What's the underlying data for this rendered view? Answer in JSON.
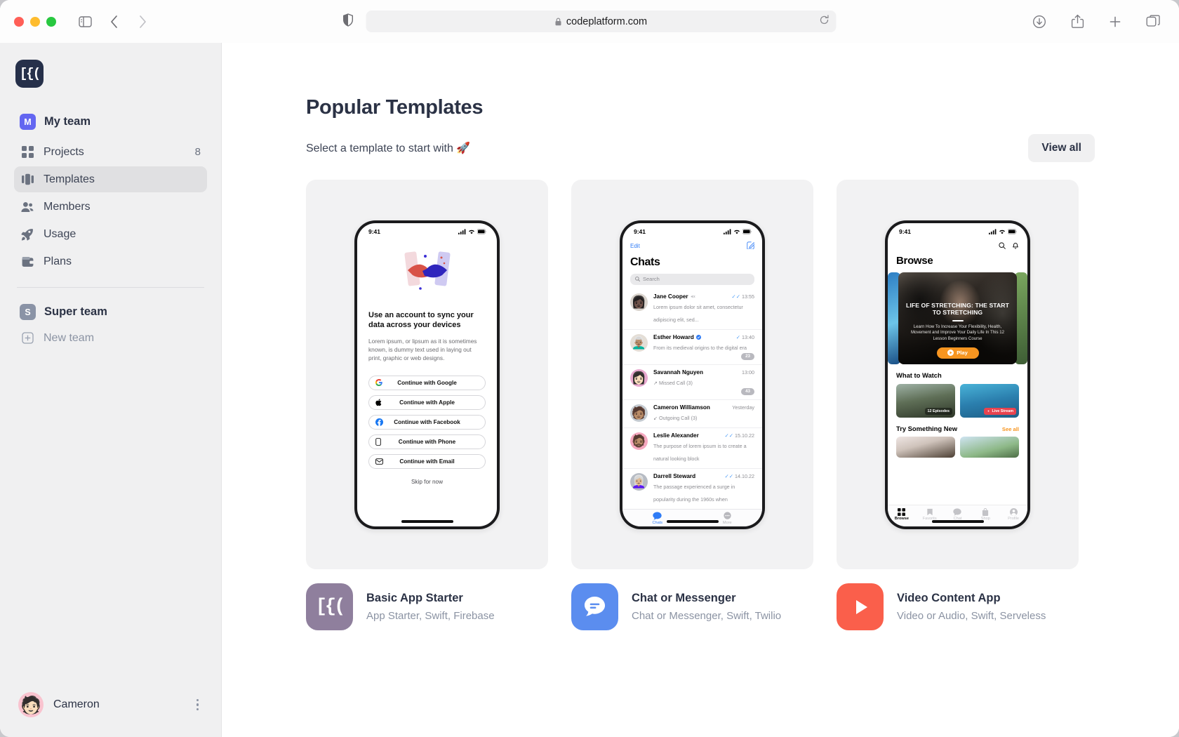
{
  "browser": {
    "url": "codeplatform.com",
    "lock_icon": "lock-icon",
    "shield_icon": "shield-icon",
    "reload_icon": "reload-icon",
    "back_icon": "back-chevron-icon",
    "forward_icon": "forward-chevron-icon",
    "sidebar_toggle_icon": "sidebar-toggle-icon",
    "downloads_icon": "downloads-icon",
    "share_icon": "share-icon",
    "new_tab_icon": "plus-icon",
    "tabs_icon": "tab-overview-icon"
  },
  "sidebar": {
    "brand": "[{(",
    "team": {
      "initial": "M",
      "name": "My team",
      "color": "#6366f1"
    },
    "items": [
      {
        "label": "Projects",
        "count": "8",
        "icon": "grid-icon",
        "active": false
      },
      {
        "label": "Templates",
        "count": "",
        "icon": "templates-icon",
        "active": true
      },
      {
        "label": "Members",
        "count": "",
        "icon": "members-icon",
        "active": false
      },
      {
        "label": "Usage",
        "count": "",
        "icon": "rocket-icon",
        "active": false
      },
      {
        "label": "Plans",
        "count": "",
        "icon": "wallet-icon",
        "active": false
      }
    ],
    "second_team": {
      "initial": "S",
      "name": "Super team",
      "color": "#8a93a6"
    },
    "new_team": {
      "label": "New team",
      "icon": "plus-box-icon"
    },
    "user": {
      "name": "Cameron",
      "menu_icon": "kebab-menu-icon"
    }
  },
  "main": {
    "title": "Popular Templates",
    "subtitle": "Select a template to start with 🚀",
    "view_all": "View all"
  },
  "templates": [
    {
      "title": "Basic App Starter",
      "subtitle": "App Starter, Swift, Firebase",
      "icon_glyph": "[{(",
      "icon_color": "#8f7f9d"
    },
    {
      "title": "Chat or Messenger",
      "subtitle": "Chat or Messenger, Swift, Twilio",
      "icon_glyph": "chat-bubble-icon",
      "icon_color": "#5b8def"
    },
    {
      "title": "Video Content App",
      "subtitle": "Video or Audio, Swift, Serveless",
      "icon_glyph": "play-icon",
      "icon_color": "#fa5f4b"
    }
  ],
  "phone1": {
    "status_time": "9:41",
    "heading": "Use an account to sync your data across your devices",
    "paragraph": "Lorem ipsum, or lipsum as it is sometimes known, is dummy text used in laying out print, graphic or web designs.",
    "buttons": [
      {
        "label": "Continue with Google",
        "icon": "google-icon"
      },
      {
        "label": "Continue with Apple",
        "icon": "apple-icon"
      },
      {
        "label": "Continue with Facebook",
        "icon": "facebook-icon"
      },
      {
        "label": "Continue with Phone",
        "icon": "phone-icon"
      },
      {
        "label": "Continue with Email",
        "icon": "email-icon"
      }
    ],
    "skip": "Skip for now"
  },
  "phone2": {
    "status_time": "9:41",
    "edit": "Edit",
    "compose_icon": "compose-icon",
    "title": "Chats",
    "search_placeholder": "Search",
    "chats": [
      {
        "name": "Jane Cooper",
        "muted": true,
        "verified": false,
        "message": "Lorem ipsum dolor sit amet, consectetur adipiscing elit, sed...",
        "time": "13:55",
        "ticks": "double",
        "badge": "",
        "avatar_color": "#d9d3cc",
        "face": "👩🏿"
      },
      {
        "name": "Esther Howard",
        "muted": false,
        "verified": true,
        "message": "From its medieval origins to the digital era",
        "time": "13:40",
        "ticks": "single",
        "badge": "23",
        "avatar_color": "#e4ded6",
        "face": "👨🏽‍🦳"
      },
      {
        "name": "Savannah Nguyen",
        "muted": false,
        "verified": false,
        "message": "↗ Missed Call (3)",
        "time": "13:00",
        "ticks": "none",
        "badge": "43",
        "avatar_color": "#e8a9cf",
        "face": "👩🏻"
      },
      {
        "name": "Cameron Williamson",
        "muted": false,
        "verified": false,
        "message": "↙ Outgoing Call (3)",
        "time": "Yesterday",
        "ticks": "none",
        "badge": "",
        "avatar_color": "#c5cbd1",
        "face": "🧑🏽"
      },
      {
        "name": "Leslie Alexander",
        "muted": false,
        "verified": false,
        "message": "The purpose of lorem ipsum is to create a natural looking block",
        "time": "15.10.22",
        "ticks": "double",
        "badge": "",
        "avatar_color": "#f5a8bf",
        "face": "🧔🏽"
      },
      {
        "name": "Darrell Steward",
        "muted": false,
        "verified": false,
        "message": "The passage experienced a surge in popularity during the 1960s when",
        "time": "14.10.22",
        "ticks": "double",
        "badge": "",
        "avatar_color": "#b7bcc4",
        "face": "👩🏼‍🦳"
      }
    ],
    "tabs": [
      {
        "label": "Chats",
        "icon": "chat-bubble-icon",
        "active": true
      },
      {
        "label": "More",
        "icon": "more-dots-icon",
        "active": false
      }
    ]
  },
  "phone3": {
    "status_time": "9:41",
    "search_icon": "search-icon",
    "bell_icon": "bell-icon",
    "title": "Browse",
    "hero": {
      "heading": "LIFE OF STRETCHING: THE START TO STRETCHING",
      "paragraph": "Learn How To Increase Your Flexibility, Health, Movement and Improve Your Daily Life In This 12 Lesson Beginners Course",
      "play_label": "Play",
      "play_icon": "play-circle-icon"
    },
    "section1": "What to Watch",
    "thumb1_tag": "12 Episodes",
    "thumb2_tag": "Live Stream",
    "section2": "Try Something New",
    "see_all": "See all",
    "tabs": [
      {
        "label": "Browse",
        "icon": "grid-icon",
        "active": true
      },
      {
        "label": "Favorits",
        "icon": "bookmark-icon",
        "active": false
      },
      {
        "label": "Chat",
        "icon": "chat-bubble-icon",
        "active": false
      },
      {
        "label": "Shop",
        "icon": "bag-icon",
        "active": false
      },
      {
        "label": "Profile",
        "icon": "person-icon",
        "active": false
      }
    ]
  }
}
